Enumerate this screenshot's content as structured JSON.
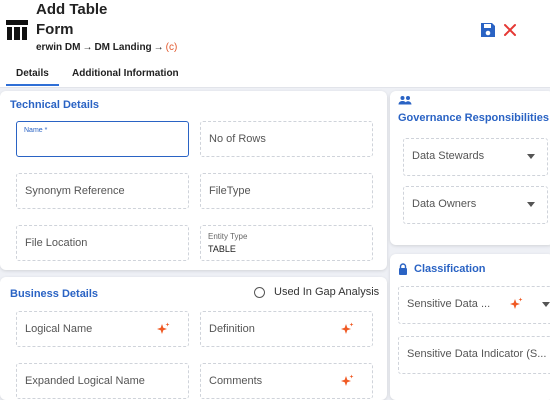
{
  "header": {
    "title_line1": "Add Table",
    "title_line2": "Form",
    "breadcrumb": {
      "root": "erwin DM",
      "sep": "→",
      "page": "DM Landing",
      "suffix": "(c)"
    },
    "save_icon": "save-icon",
    "close_icon": "close-icon"
  },
  "tabs": [
    {
      "label": "Details",
      "active": true
    },
    {
      "label": "Additional Information",
      "active": false
    }
  ],
  "technical": {
    "title": "Technical Details",
    "name_label": "Name *",
    "rows_placeholder": "No of Rows",
    "synonym_placeholder": "Synonym Reference",
    "filetype_placeholder": "FileType",
    "location_placeholder": "File Location",
    "entity_type_label": "Entity Type",
    "entity_type_value": "TABLE"
  },
  "governance": {
    "title": "Governance Responsibilities",
    "stewards": "Data Stewards",
    "owners": "Data Owners"
  },
  "classification": {
    "title": "Classification",
    "sensitive_data": "Sensitive Data ...",
    "sensitive_indicator": "Sensitive Data Indicator (S..."
  },
  "business": {
    "title": "Business Details",
    "gap_label": "Used In Gap Analysis",
    "logical_name": "Logical Name",
    "definition": "Definition",
    "expanded_logical_name": "Expanded Logical Name",
    "comments": "Comments"
  },
  "colors": {
    "accent": "#2a63c4",
    "danger": "#e53935",
    "sparkle": "#f05a24"
  }
}
